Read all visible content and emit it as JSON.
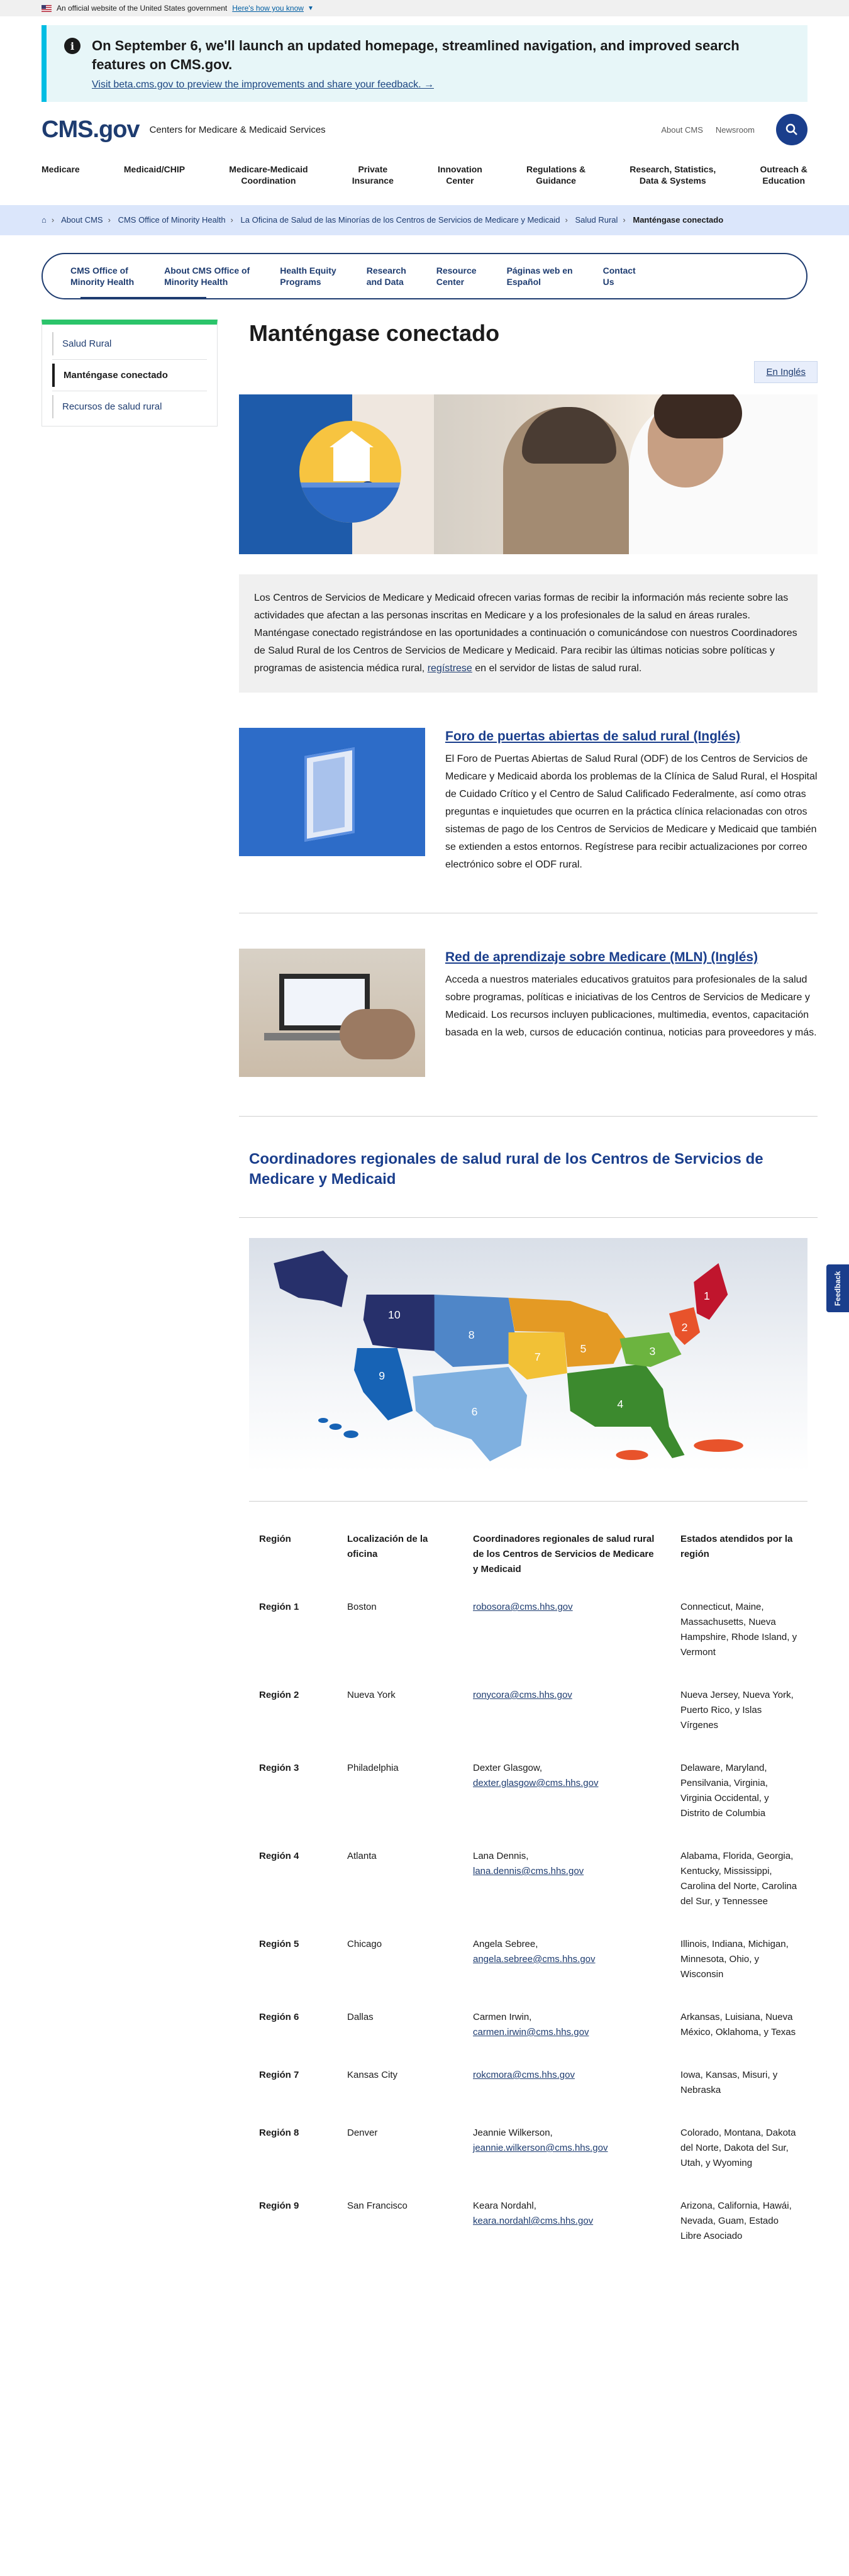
{
  "gov_banner": {
    "text": "An official website of the United States government",
    "link": "Here's how you know"
  },
  "alert": {
    "title": "On September 6, we'll launch an updated homepage, streamlined navigation, and improved search features on CMS.gov.",
    "link": "Visit beta.cms.gov to preview the improvements and share your feedback. →"
  },
  "header": {
    "logo": "CMS.gov",
    "subtitle": "Centers for Medicare & Medicaid Services",
    "util_links": [
      "About CMS",
      "Newsroom"
    ]
  },
  "nav": [
    "Medicare",
    "Medicaid/CHIP",
    "Medicare-Medicaid\nCoordination",
    "Private\nInsurance",
    "Innovation\nCenter",
    "Regulations &\nGuidance",
    "Research, Statistics,\nData & Systems",
    "Outreach &\nEducation"
  ],
  "breadcrumb": {
    "items": [
      "About CMS",
      "CMS Office of Minority Health",
      "La Oficina de Salud de las Minorías de los Centros de Servicios de Medicare y Medicaid",
      "Salud Rural"
    ],
    "current": "Manténgase conectado"
  },
  "subnav": [
    "CMS Office of\nMinority Health",
    "About CMS Office of\nMinority Health",
    "Health Equity\nPrograms",
    "Research\nand Data",
    "Resource\nCenter",
    "Páginas web en\nEspañol",
    "Contact\nUs"
  ],
  "sidebar": [
    "Salud Rural",
    "Manténgase conectado",
    "Recursos de salud rural"
  ],
  "page": {
    "title": "Manténgase conectado",
    "lang_button": "En Inglés",
    "intro_text": "Los Centros de Servicios de Medicare y Medicaid ofrecen varias formas de recibir la información más reciente sobre las actividades que afectan a las personas inscritas en Medicare y a los profesionales de la salud en áreas rurales. Manténgase conectado registrándose en las oportunidades a continuación o comunicándose con nuestros Coordinadores de Salud Rural de los Centros de Servicios de Medicare y Medicaid. Para recibir las últimas noticias sobre políticas y programas de asistencia médica rural, ",
    "intro_link": "regístrese",
    "intro_tail": " en el servidor de listas de salud rural."
  },
  "cards": [
    {
      "title": "Foro de puertas abiertas de salud rural (Inglés)",
      "text": "El Foro de Puertas Abiertas de Salud Rural (ODF) de los Centros de Servicios de Medicare y Medicaid aborda los problemas de la Clínica de Salud Rural, el Hospital de Cuidado Crítico y el Centro de Salud Calificado Federalmente, así como otras preguntas e inquietudes que ocurren en la práctica clínica relacionadas con otros sistemas de pago de los Centros de Servicios de Medicare y Medicaid que también se extienden a estos entornos. Regístrese para recibir actualizaciones por correo electrónico sobre el ODF rural."
    },
    {
      "title": "Red de aprendizaje sobre Medicare (MLN) (Inglés)",
      "text": "Acceda a nuestros materiales educativos gratuitos para profesionales de la salud sobre programas, políticas e iniciativas de los Centros de Servicios de Medicare y Medicaid. Los recursos incluyen publicaciones, multimedia, eventos, capacitación basada en la web, cursos de educación continua, noticias para proveedores y más."
    }
  ],
  "section_title": "Coordinadores regionales de salud rural de los Centros de Servicios de Medicare y Medicaid",
  "map_labels": [
    "1",
    "2",
    "3",
    "4",
    "5",
    "6",
    "7",
    "8",
    "9",
    "10"
  ],
  "map_colors": {
    "r1": "#c0152d",
    "r2": "#e8532b",
    "r3": "#6cb43f",
    "r4": "#3c8a2e",
    "r5": "#e49a24",
    "r6": "#7fb0e0",
    "r7": "#f2c136",
    "r8": "#4f86c8",
    "r9": "#1763b5",
    "r10": "#27306b"
  },
  "table": {
    "headers": [
      "Región",
      "Localización de la oficina",
      "Coordinadores regionales de salud rural de los Centros de Servicios de Medicare y Medicaid",
      "Estados atendidos por la región"
    ],
    "rows": [
      {
        "region": "Región 1",
        "office": "Boston",
        "name": "",
        "email": "robosora@cms.hhs.gov",
        "states": "Connecticut, Maine, Massachusetts, Nueva Hampshire, Rhode Island, y Vermont"
      },
      {
        "region": "Región 2",
        "office": "Nueva York",
        "name": "",
        "email": "ronycora@cms.hhs.gov",
        "states": "Nueva Jersey, Nueva York, Puerto Rico, y Islas Vírgenes"
      },
      {
        "region": "Región 3",
        "office": "Philadelphia",
        "name": "Dexter Glasgow,",
        "email": "dexter.glasgow@cms.hhs.gov",
        "states": "Delaware, Maryland, Pensilvania, Virginia, Virginia Occidental, y Distrito de Columbia"
      },
      {
        "region": "Región 4",
        "office": "Atlanta",
        "name": "Lana Dennis,",
        "email": "lana.dennis@cms.hhs.gov",
        "states": "Alabama, Florida, Georgia, Kentucky, Mississippi, Carolina del Norte, Carolina del Sur, y Tennessee"
      },
      {
        "region": "Región 5",
        "office": "Chicago",
        "name": "Angela Sebree,",
        "email": "angela.sebree@cms.hhs.gov",
        "states": "Illinois, Indiana, Michigan, Minnesota, Ohio, y Wisconsin"
      },
      {
        "region": "Región 6",
        "office": "Dallas",
        "name": "Carmen Irwin,",
        "email": "carmen.irwin@cms.hhs.gov",
        "states": "Arkansas, Luisiana, Nueva México, Oklahoma, y Texas"
      },
      {
        "region": "Región 7",
        "office": "Kansas City",
        "name": "",
        "email": "rokcmora@cms.hhs.gov",
        "states": "Iowa, Kansas, Misuri, y Nebraska"
      },
      {
        "region": "Región 8",
        "office": "Denver",
        "name": "Jeannie Wilkerson,",
        "email": "jeannie.wilkerson@cms.hhs.gov",
        "states": "Colorado, Montana, Dakota del Norte, Dakota del Sur, Utah, y Wyoming"
      },
      {
        "region": "Región 9",
        "office": "San Francisco",
        "name": "Keara Nordahl,",
        "email": "keara.nordahl@cms.hhs.gov",
        "states": "Arizona, California, Hawái, Nevada, Guam, Estado Libre Asociado"
      }
    ]
  },
  "feedback": "Feedback"
}
